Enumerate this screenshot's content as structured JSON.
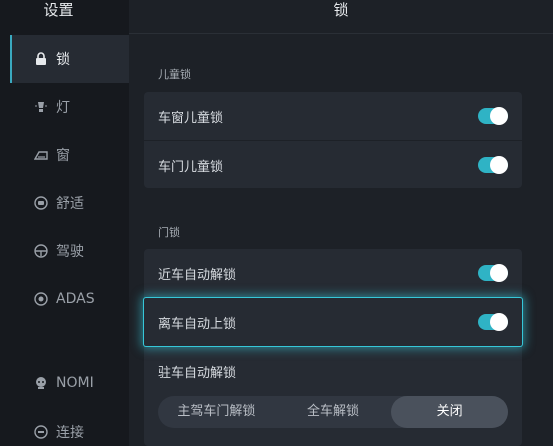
{
  "sidebar": {
    "title": "设置",
    "items": [
      {
        "label": "锁",
        "icon": "lock-icon"
      },
      {
        "label": "灯",
        "icon": "light-icon"
      },
      {
        "label": "窗",
        "icon": "window-icon"
      },
      {
        "label": "舒适",
        "icon": "comfort-icon"
      },
      {
        "label": "驾驶",
        "icon": "steering-wheel-icon"
      },
      {
        "label": "ADAS",
        "icon": "adas-icon"
      },
      {
        "label": "NOMI",
        "icon": "nomi-icon"
      },
      {
        "label": "连接",
        "icon": "link-icon"
      }
    ]
  },
  "main": {
    "title": "锁",
    "child_lock_section": {
      "label": "儿童锁",
      "rows": [
        {
          "label": "车窗儿童锁",
          "on": true
        },
        {
          "label": "车门儿童锁",
          "on": true
        }
      ]
    },
    "door_lock_section": {
      "label": "门锁",
      "rows": [
        {
          "label": "近车自动解锁",
          "on": true
        },
        {
          "label": "离车自动上锁",
          "on": true
        },
        {
          "label": "驻车自动解锁"
        }
      ],
      "parking_unlock_options": [
        "主驾车门解锁",
        "全车解锁",
        "关闭"
      ],
      "parking_unlock_selected": "关闭"
    }
  },
  "colors": {
    "accent": "#2fb3c5",
    "highlight_glow": "#36c7d9"
  }
}
